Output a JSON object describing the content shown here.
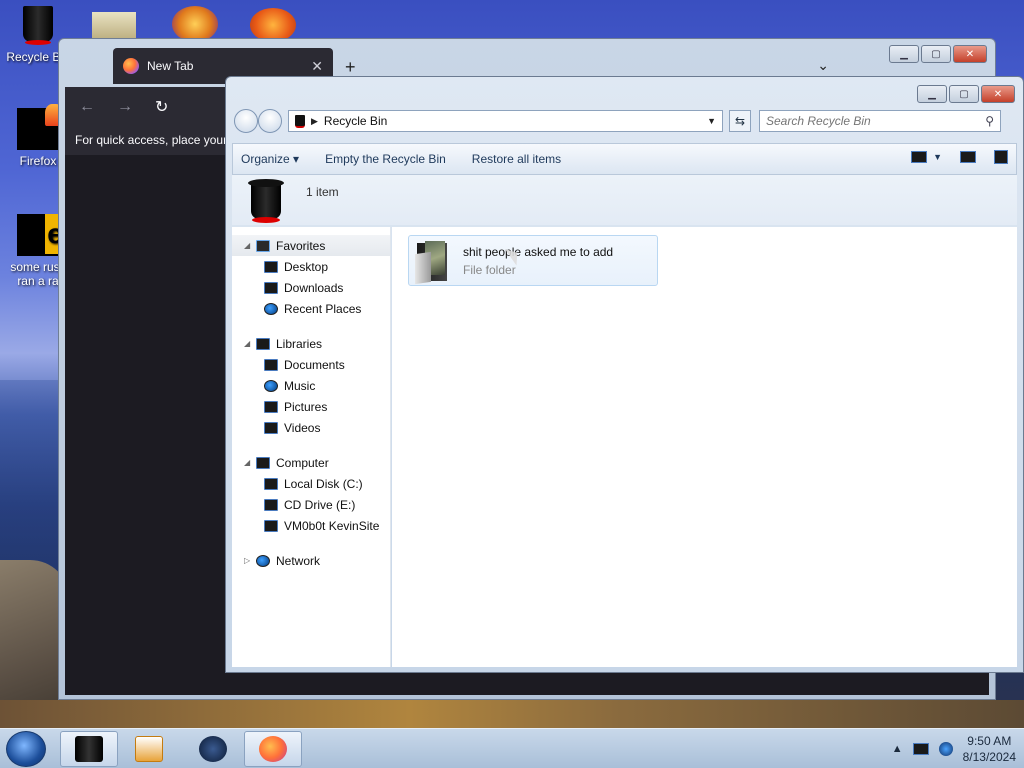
{
  "desktop": {
    "icons": [
      {
        "label": "Recycle Bin",
        "icon": "recycle-bin-icon"
      },
      {
        "label": "Firefox",
        "icon": "firefox-icon"
      },
      {
        "label": "some russ\nran a ra",
        "icon": "document-icon"
      }
    ]
  },
  "browser": {
    "tab_title": "New Tab",
    "tab_close": "✕",
    "new_tab": "+",
    "list_tabs": "⌄",
    "nav_back": "←",
    "nav_forward": "→",
    "nav_reload": "↻",
    "bookmarks_hint": "For quick access, place your"
  },
  "explorer": {
    "breadcrumb": "Recycle Bin",
    "search_placeholder": "Search Recycle Bin",
    "toolbar": {
      "organize": "Organize",
      "empty_bin": "Empty the Recycle Bin",
      "restore_all": "Restore all items"
    },
    "item_count": "1 item",
    "nav": {
      "favorites": {
        "label": "Favorites",
        "items": [
          "Desktop",
          "Downloads",
          "Recent Places"
        ]
      },
      "libraries": {
        "label": "Libraries",
        "items": [
          "Documents",
          "Music",
          "Pictures",
          "Videos"
        ]
      },
      "computer": {
        "label": "Computer",
        "items": [
          "Local Disk (C:)",
          "CD Drive (E:)",
          "VM0b0t KevinSite"
        ]
      },
      "network": {
        "label": "Network"
      }
    },
    "files": [
      {
        "name": "shit people asked me to add",
        "type": "File folder"
      }
    ]
  },
  "taskbar": {
    "time": "9:50 AM",
    "date": "8/13/2024",
    "tray_arrow": "▲"
  }
}
